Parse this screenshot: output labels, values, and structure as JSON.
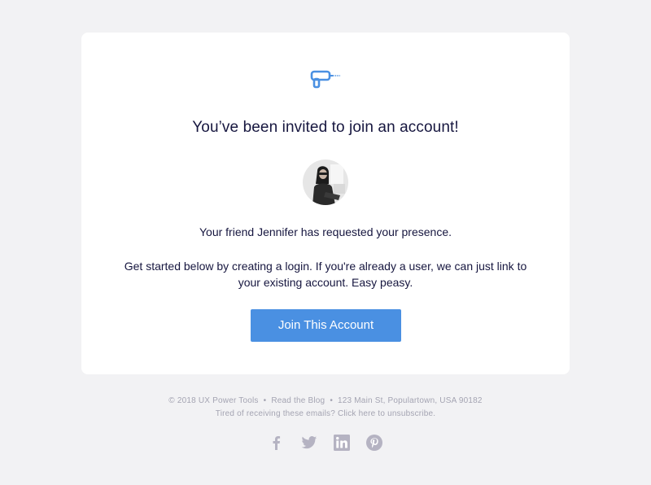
{
  "email": {
    "headline": "You’ve been invited to join an account!",
    "friend_line": "Your friend Jennifer has requested your presence.",
    "body_line1": "Get started below by creating a login. If you're already a user, we can just link to",
    "body_line2": "your existing account. Easy peasy.",
    "cta_label": "Join This Account"
  },
  "footer": {
    "copyright": "© 2018 UX Power Tools",
    "blog_link": "Read the Blog",
    "address": "123 Main St, Populartown, USA 90182",
    "unsubscribe": "Tired of receiving these emails? Click here to unsubscribe.",
    "separator": "•"
  },
  "social": [
    "facebook-icon",
    "twitter-icon",
    "linkedin-icon",
    "pinterest-icon"
  ],
  "colors": {
    "accent": "#4a90e2",
    "text": "#16163f",
    "muted": "#a4a4b2",
    "icon": "#b5b3c2",
    "background": "#f2f2f4"
  }
}
